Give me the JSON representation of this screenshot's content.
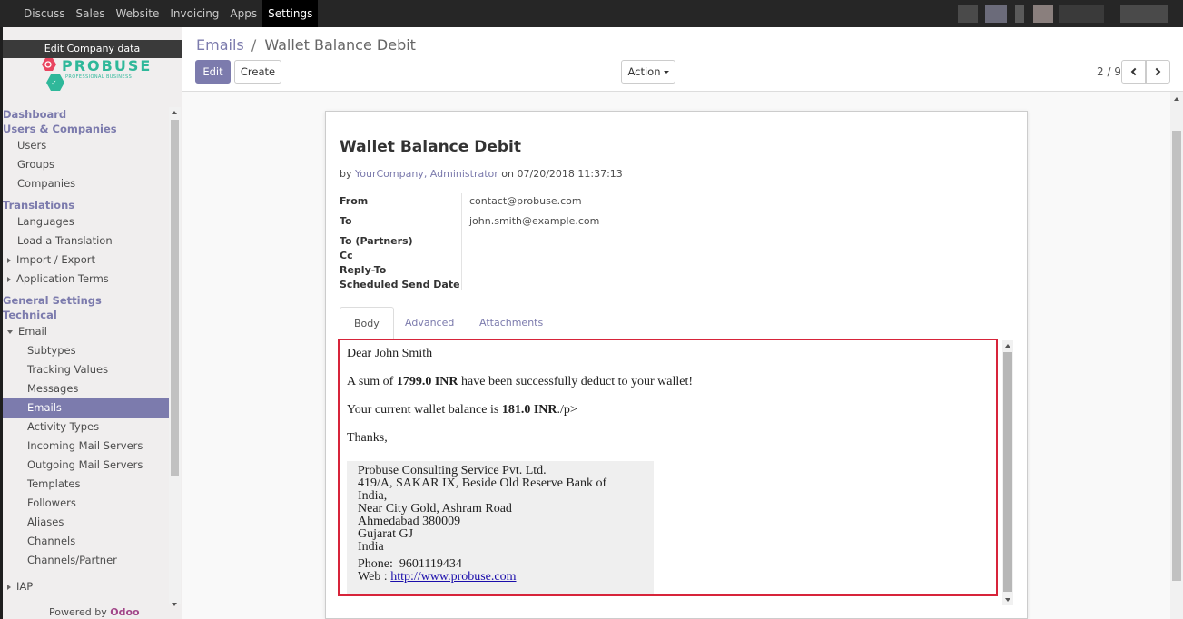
{
  "topbar": {
    "apps": [
      "Discuss",
      "Sales",
      "Website",
      "Invoicing",
      "Apps",
      "Settings"
    ],
    "active": "Settings"
  },
  "sidebar": {
    "edit_company": "Edit Company data",
    "logo_word": "PROBUSE",
    "logo_tagline": "PROFESSIONAL BUSINESS",
    "items": [
      {
        "label": "Dashboard",
        "type": "head"
      },
      {
        "label": "Users & Companies",
        "type": "head"
      },
      {
        "label": "Users",
        "type": "l1"
      },
      {
        "label": "Groups",
        "type": "l1"
      },
      {
        "label": "Companies",
        "type": "l1"
      },
      {
        "label": "Translations",
        "type": "head"
      },
      {
        "label": "Languages",
        "type": "l1"
      },
      {
        "label": "Load a Translation",
        "type": "l1"
      },
      {
        "label": "Import / Export",
        "type": "l1",
        "caret": "right"
      },
      {
        "label": "Application Terms",
        "type": "l1",
        "caret": "right"
      },
      {
        "label": "General Settings",
        "type": "head"
      },
      {
        "label": "Technical",
        "type": "head"
      },
      {
        "label": "Email",
        "type": "l1",
        "caret": "down"
      },
      {
        "label": "Subtypes",
        "type": "l2"
      },
      {
        "label": "Tracking Values",
        "type": "l2"
      },
      {
        "label": "Messages",
        "type": "l2"
      },
      {
        "label": "Emails",
        "type": "l2",
        "active": true
      },
      {
        "label": "Activity Types",
        "type": "l2"
      },
      {
        "label": "Incoming Mail Servers",
        "type": "l2"
      },
      {
        "label": "Outgoing Mail Servers",
        "type": "l2"
      },
      {
        "label": "Templates",
        "type": "l2"
      },
      {
        "label": "Followers",
        "type": "l2"
      },
      {
        "label": "Aliases",
        "type": "l2"
      },
      {
        "label": "Channels",
        "type": "l2"
      },
      {
        "label": "Channels/Partner",
        "type": "l2"
      },
      {
        "label": "IAP",
        "type": "l1",
        "caret": "right"
      }
    ],
    "powered_by": "Powered by",
    "powered_brand": "Odoo"
  },
  "control": {
    "breadcrumb_parent": "Emails",
    "breadcrumb_sep": "/",
    "breadcrumb_current": "Wallet Balance Debit",
    "edit_label": "Edit",
    "create_label": "Create",
    "action_label": "Action",
    "pager": "2 / 9"
  },
  "record": {
    "title": "Wallet Balance Debit",
    "by_prefix": "by",
    "author": "YourCompany, Administrator",
    "on_prefix": "on",
    "date": "07/20/2018 11:37:13",
    "fields": {
      "from_label": "From",
      "from_value": "contact@probuse.com",
      "to_label": "To",
      "to_value": "john.smith@example.com",
      "partners_label": "To (Partners)",
      "cc_label": "Cc",
      "reply_to_label": "Reply-To",
      "scheduled_label": "Scheduled Send Date"
    },
    "tabs": [
      "Body",
      "Advanced",
      "Attachments"
    ],
    "active_tab": "Body"
  },
  "email_body": {
    "greeting": "Dear John Smith",
    "line1_pre": "A sum of ",
    "line1_amount": "1799.0 INR",
    "line1_post": " have been successfully deduct to your wallet!",
    "line2_pre": "Your current wallet balance is ",
    "line2_amount": "181.0 INR",
    "line2_post": "./p>",
    "thanks": "Thanks,",
    "signature": {
      "company": "Probuse Consulting Service Pvt. Ltd.",
      "address1": "419/A, SAKAR IX, Beside Old Reserve Bank of",
      "address2": "India,",
      "address3": "Near City Gold, Ashram Road",
      "city": "Ahmedabad 380009",
      "state": "Gujarat GJ",
      "country": "India",
      "phone_label": "Phone:",
      "phone": "9601119434",
      "web_label": "Web :",
      "web": "http://www.probuse.com"
    }
  },
  "colors": {
    "brand": "#7c7bad",
    "highlight_border": "#d7243a",
    "topbar": "#262626"
  }
}
